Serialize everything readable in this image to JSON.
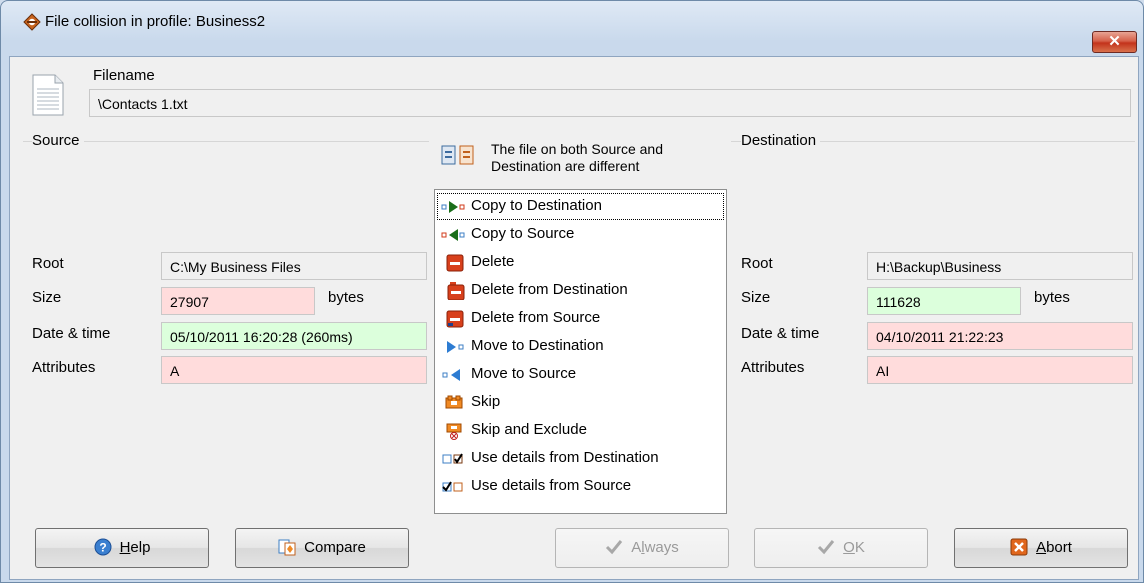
{
  "window": {
    "title": "File collision in profile: Business2",
    "close_glyph": "✕"
  },
  "filename": {
    "label": "Filename",
    "value": "\\Contacts 1.txt"
  },
  "source": {
    "group_label": "Source",
    "root_label": "Root",
    "root_value": "C:\\My Business Files",
    "size_label": "Size",
    "size_value": "27907",
    "size_unit": "bytes",
    "date_label": "Date & time",
    "date_value": "05/10/2011 16:20:28 (260ms)",
    "attr_label": "Attributes",
    "attr_value": "A"
  },
  "destination": {
    "group_label": "Destination",
    "root_label": "Root",
    "root_value": "H:\\Backup\\Business",
    "size_label": "Size",
    "size_value": "111628",
    "size_unit": "bytes",
    "date_label": "Date & time",
    "date_value": "04/10/2011 21:22:23",
    "attr_label": "Attributes",
    "attr_value": "AI"
  },
  "status": {
    "line1": "The file on both Source and",
    "line2": "Destination are different"
  },
  "actions": [
    {
      "label": "Copy to Destination",
      "icon": "copy-to-destination-icon",
      "selected": true
    },
    {
      "label": "Copy to Source",
      "icon": "copy-to-source-icon"
    },
    {
      "label": "Delete",
      "icon": "delete-icon"
    },
    {
      "label": "Delete from Destination",
      "icon": "delete-from-destination-icon"
    },
    {
      "label": "Delete from Source",
      "icon": "delete-from-source-icon"
    },
    {
      "label": "Move to Destination",
      "icon": "move-to-destination-icon"
    },
    {
      "label": "Move to Source",
      "icon": "move-to-source-icon"
    },
    {
      "label": "Skip",
      "icon": "skip-icon"
    },
    {
      "label": "Skip and Exclude",
      "icon": "skip-exclude-icon"
    },
    {
      "label": "Use details from Destination",
      "icon": "use-destination-details-icon"
    },
    {
      "label": "Use details from Source",
      "icon": "use-source-details-icon"
    }
  ],
  "buttons": {
    "help": {
      "u": "H",
      "rest": "elp",
      "icon": "help-icon"
    },
    "compare": {
      "label": "Compare",
      "icon": "compare-icon"
    },
    "always": {
      "pre": "A",
      "u": "l",
      "rest": "ways",
      "icon": "check-icon"
    },
    "ok": {
      "u": "O",
      "rest": "K",
      "icon": "check-icon"
    },
    "abort": {
      "u": "A",
      "rest": "bort",
      "icon": "abort-icon"
    }
  },
  "colors": {
    "different": "#ffdcdc",
    "newer": "#dcffdc",
    "title_bg": "#c9d9ec"
  }
}
